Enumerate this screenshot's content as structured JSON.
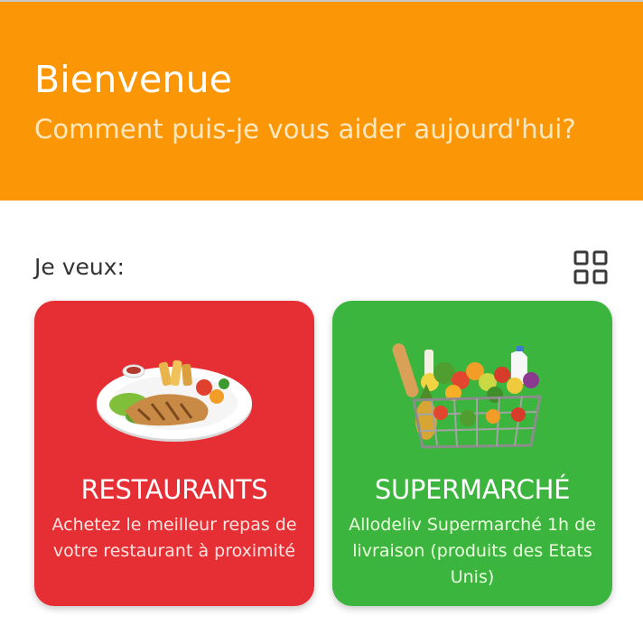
{
  "header": {
    "title": "Bienvenue",
    "subtitle": "Comment puis-je vous aider aujourd'hui?",
    "background_color": "#fb9706"
  },
  "section": {
    "label": "Je veux:",
    "view_toggle_icon": "grid-icon"
  },
  "cards": [
    {
      "title": "RESTAURANTS",
      "description": "Achetez le meilleur repas de votre restaurant à proximité",
      "color": "#e62f34",
      "image": "grilled-chicken-plate"
    },
    {
      "title": "SUPERMARCHÉ",
      "description": "Allodeliv Supermarché 1h de livraison (produits des Etats Unis)",
      "color": "#3cb53e",
      "image": "grocery-basket"
    }
  ]
}
